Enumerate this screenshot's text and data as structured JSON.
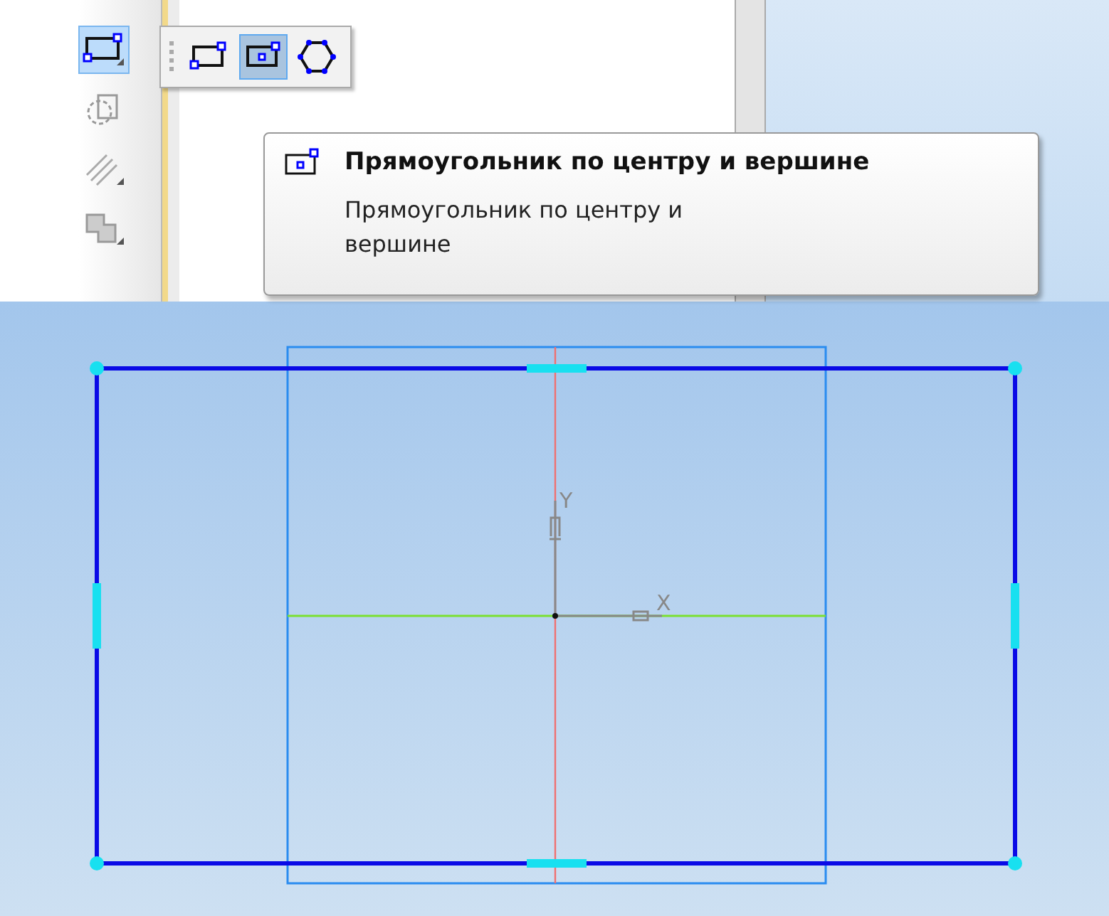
{
  "toolbar": {
    "items": [
      {
        "kind": "rectangle",
        "selected": true
      },
      {
        "kind": "rotate",
        "selected": false
      },
      {
        "kind": "hatch-lines",
        "selected": false
      },
      {
        "kind": "fill",
        "selected": false
      }
    ]
  },
  "flyout": {
    "items": [
      {
        "kind": "corner-rectangle",
        "selected": false
      },
      {
        "kind": "center-rectangle",
        "selected": true
      },
      {
        "kind": "polygon",
        "selected": false
      }
    ]
  },
  "tooltip": {
    "title": "Прямоугольник по центру и вершине",
    "description": "Прямоугольник по центру и вершине"
  },
  "canvas": {
    "y_axis_label": "Y",
    "x_axis_label": "X"
  }
}
